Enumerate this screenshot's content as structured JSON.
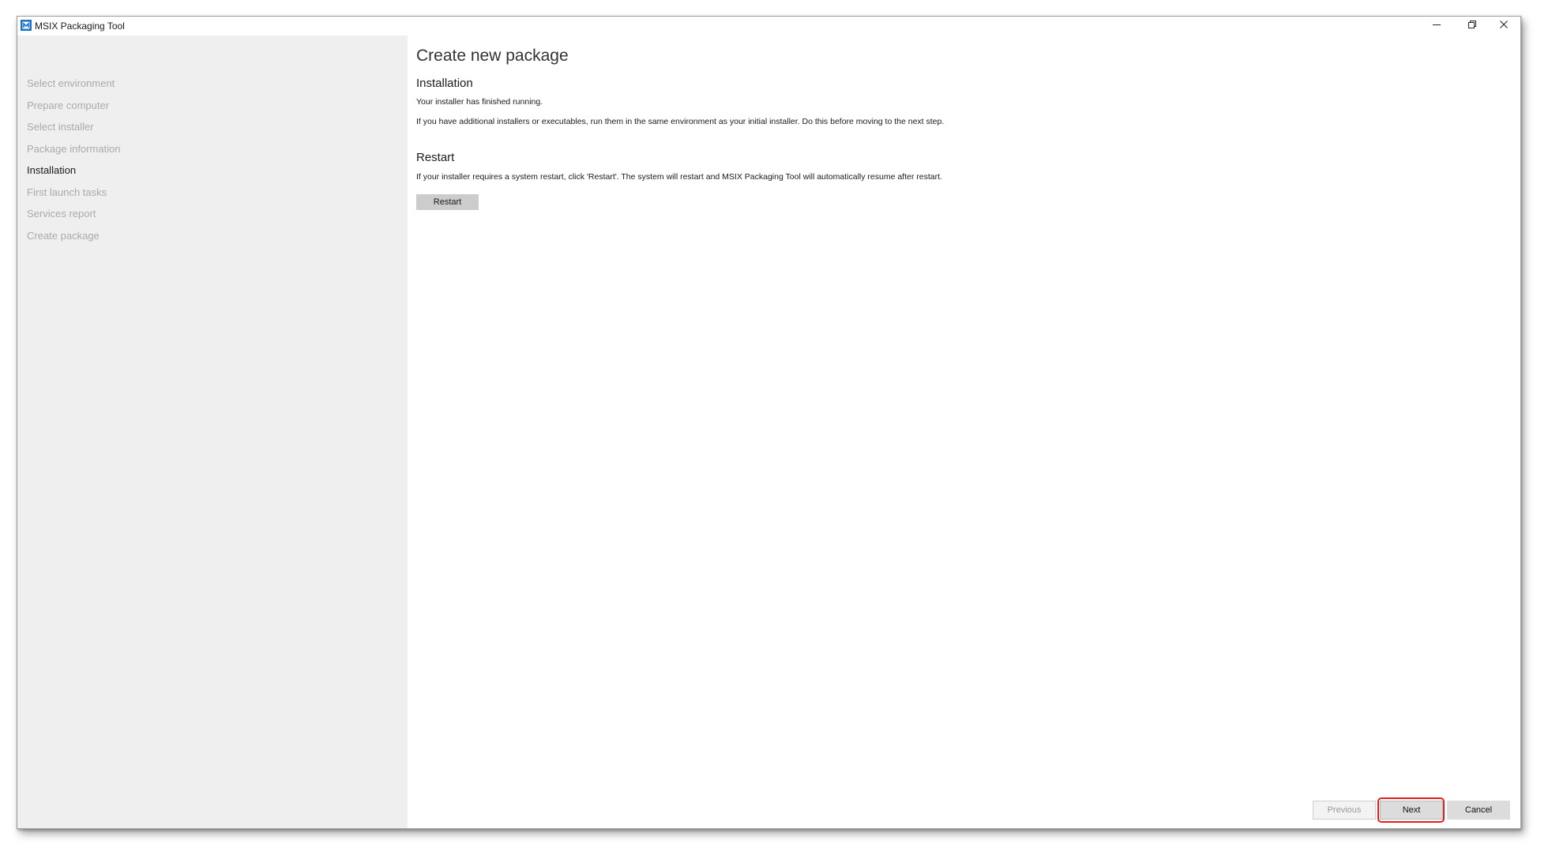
{
  "window": {
    "title": "MSIX Packaging Tool",
    "icon": "msix-app-icon",
    "controls": [
      "minimize-icon",
      "restore-icon",
      "close-icon"
    ]
  },
  "sidebar": {
    "steps": [
      {
        "label": "Select environment",
        "state": "inactive"
      },
      {
        "label": "Prepare computer",
        "state": "inactive"
      },
      {
        "label": "Select installer",
        "state": "inactive"
      },
      {
        "label": "Package information",
        "state": "inactive"
      },
      {
        "label": "Installation",
        "state": "active"
      },
      {
        "label": "First launch tasks",
        "state": "inactive"
      },
      {
        "label": "Services report",
        "state": "inactive"
      },
      {
        "label": "Create package",
        "state": "inactive"
      }
    ]
  },
  "main": {
    "page_title": "Create new package",
    "installation": {
      "heading": "Installation",
      "line1": "Your installer has finished running.",
      "line2": "If you have additional installers or executables, run them in the same environment as your initial installer. Do this before moving to the next step."
    },
    "restart": {
      "heading": "Restart",
      "description": "If your installer requires a system restart, click 'Restart'. The system will restart and MSIX Packaging Tool will automatically resume after restart.",
      "button_label": "Restart"
    }
  },
  "footer": {
    "previous_label": "Previous",
    "next_label": "Next",
    "cancel_label": "Cancel",
    "previous_enabled": false
  },
  "colors": {
    "sidebar_bg": "#efefef",
    "inactive_step": "#aaaaaa",
    "active_step": "#1a1a1a",
    "highlight": "#e02020",
    "icon_blue": "#1a73c8"
  }
}
